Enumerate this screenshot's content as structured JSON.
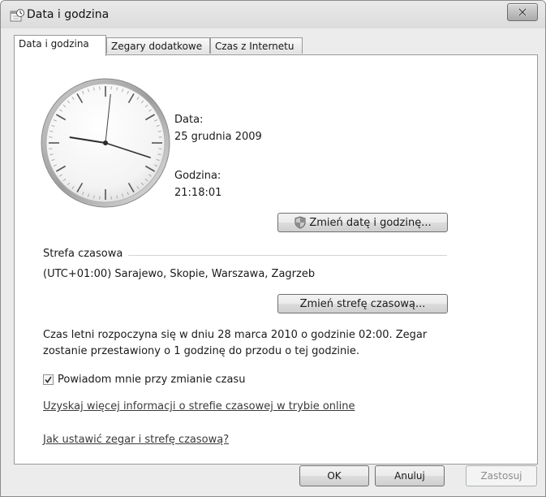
{
  "window": {
    "title": "Data i godzina",
    "app_icon": "clock-calendar-icon",
    "close_icon": "close-icon"
  },
  "tabs": [
    {
      "label": "Data i godzina",
      "active": true
    },
    {
      "label": "Zegary dodatkowe",
      "active": false
    },
    {
      "label": "Czas z Internetu",
      "active": false
    }
  ],
  "clock": {
    "time": "21:18:01"
  },
  "date_section": {
    "date_label": "Data:",
    "date_value": "25 grudnia 2009",
    "time_label": "Godzina:",
    "time_value": "21:18:01",
    "change_button": "Zmień datę i godzinę...",
    "change_button_icon": "uac-shield-icon"
  },
  "timezone_section": {
    "heading": "Strefa czasowa",
    "value": "(UTC+01:00) Sarajewo, Skopie, Warszawa, Zagrzeb",
    "change_button": "Zmień strefę czasową...",
    "dst_line1": "Czas letni rozpoczyna się w dniu 28 marca 2010 o godzinie 02:00. Zegar",
    "dst_line2": "zostanie przestawiony o 1 godzinę do przodu o tej godzinie.",
    "notify_checkbox_label": "Powiadom mnie przy zmianie czasu",
    "notify_checked": true,
    "online_info_link": "Uzyskaj więcej informacji o strefie czasowej w trybie online",
    "help_link": "Jak ustawić zegar i strefę czasową?"
  },
  "footer": {
    "ok": "OK",
    "cancel": "Anuluj",
    "apply": "Zastosuj"
  }
}
